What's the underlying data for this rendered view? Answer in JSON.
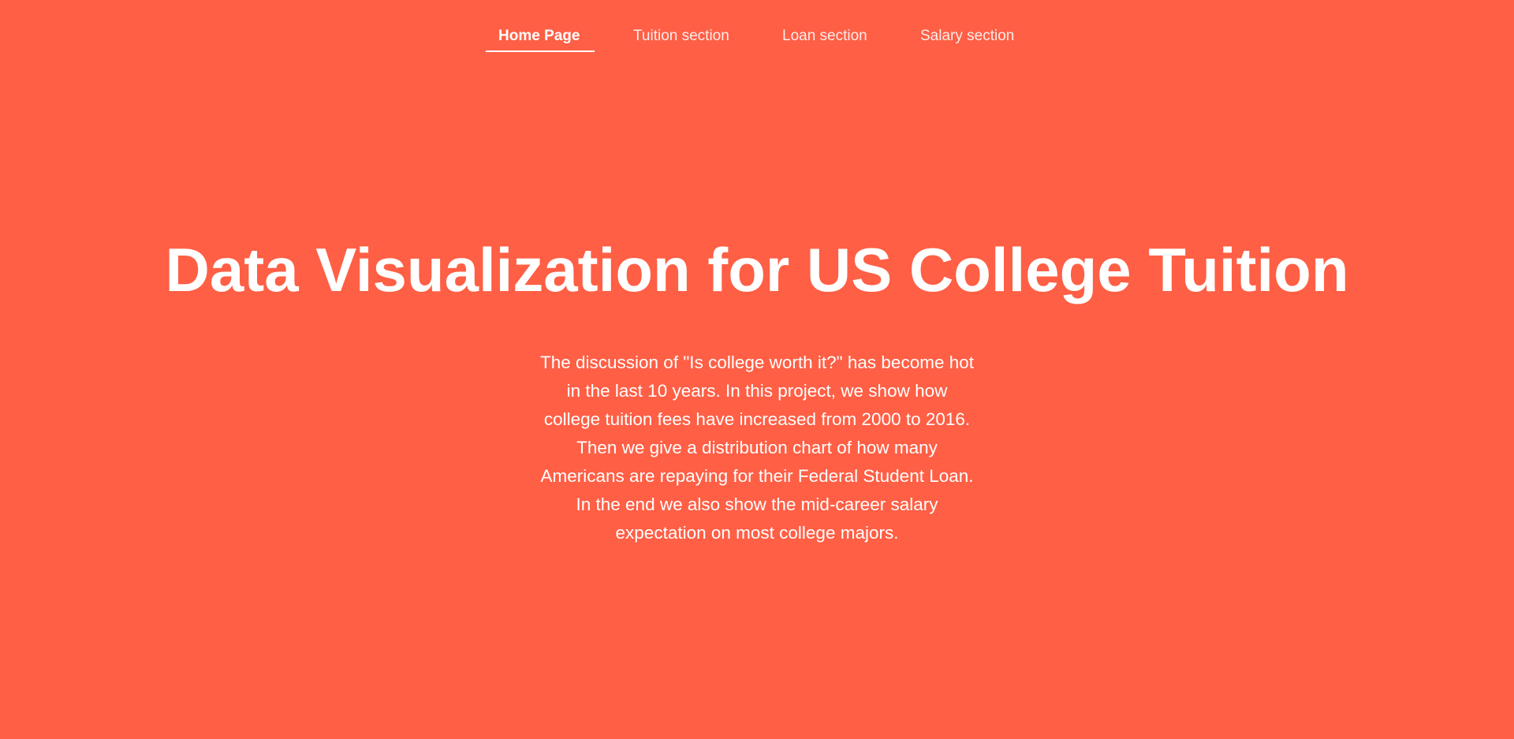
{
  "nav": {
    "items": [
      {
        "label": "Home Page",
        "active": true
      },
      {
        "label": "Tuition section",
        "active": false
      },
      {
        "label": "Loan section",
        "active": false
      },
      {
        "label": "Salary section",
        "active": false
      }
    ]
  },
  "hero": {
    "title": "Data Visualization for US College Tuition",
    "description": "The discussion of \"Is college worth it?\" has become hot in the last 10 years. In this project, we show how college tuition fees have increased from 2000 to 2016. Then we give a distribution chart of how many Americans are repaying for their Federal Student Loan. In the end we also show the mid-career salary expectation on most college majors."
  },
  "colors": {
    "background": "#ff5f45",
    "text": "#ffffff"
  }
}
